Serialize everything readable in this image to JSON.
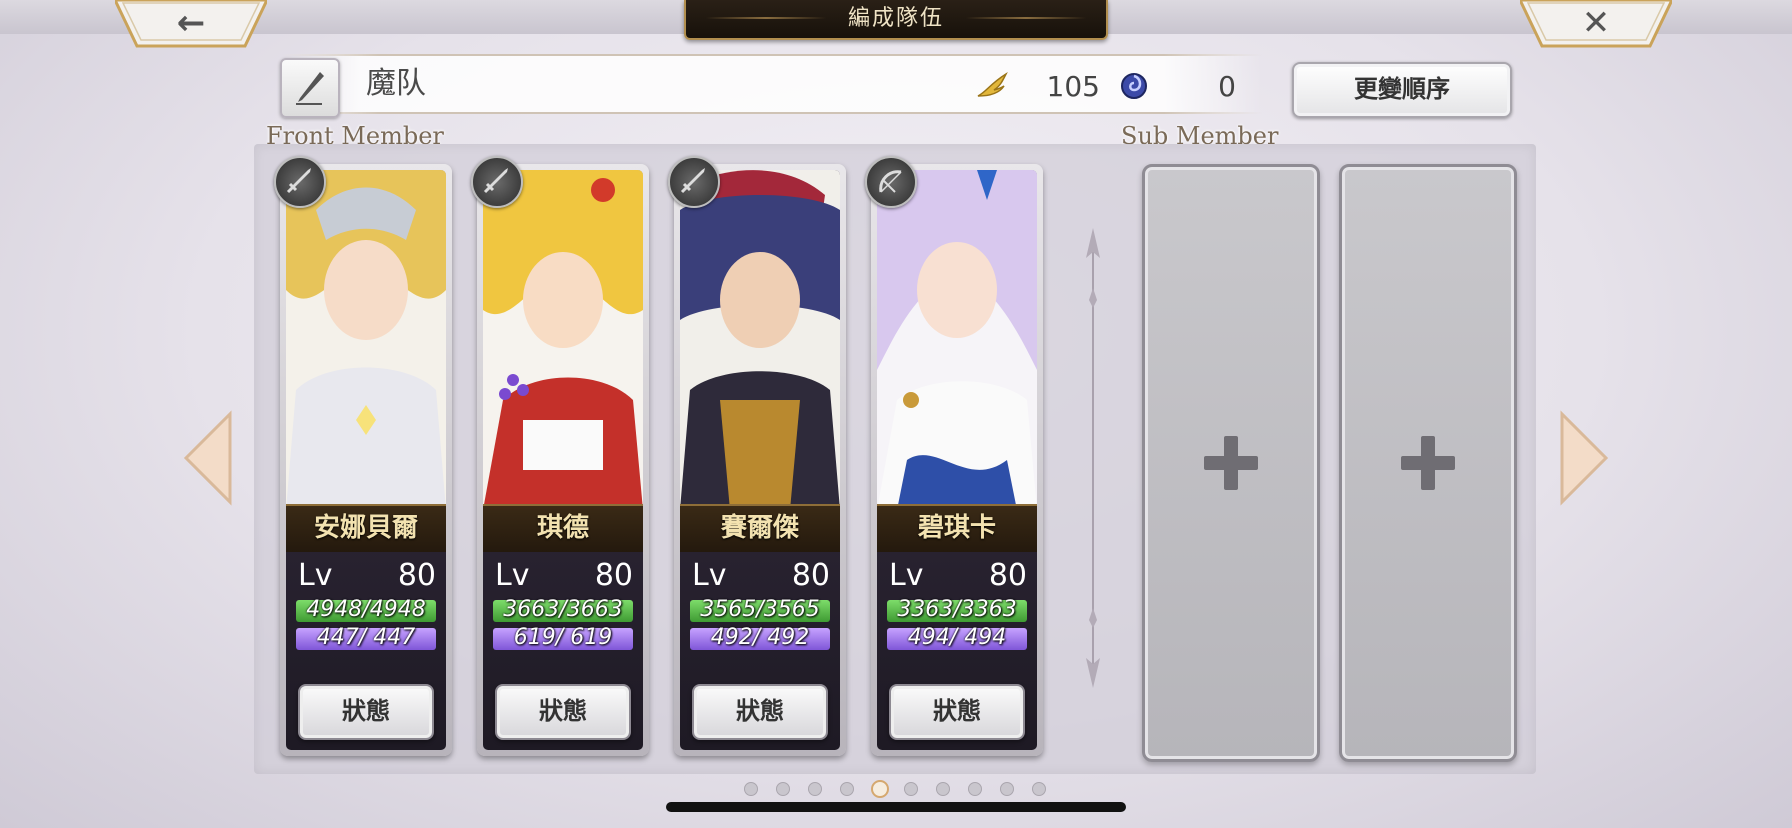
{
  "header": {
    "title": "編成隊伍",
    "back_icon": "←",
    "close_icon": "✕"
  },
  "party": {
    "name": "魔队",
    "wing_count": "105",
    "orb_count": "0",
    "change_order_label": "更變順序"
  },
  "sections": {
    "front_label": "Front Member",
    "sub_label": "Sub Member"
  },
  "members": [
    {
      "name": "安娜貝爾",
      "weapon_icon": "sword-icon",
      "lv_label": "Lv",
      "level": "80",
      "hp": "4948/4948",
      "mp": "447/ 447",
      "status_label": "狀態",
      "accent": "#e7c45a"
    },
    {
      "name": "琪德",
      "weapon_icon": "sword-icon",
      "lv_label": "Lv",
      "level": "80",
      "hp": "3663/3663",
      "mp": "619/ 619",
      "status_label": "狀態",
      "accent": "#f0c640"
    },
    {
      "name": "賽爾傑",
      "weapon_icon": "sword-icon",
      "lv_label": "Lv",
      "level": "80",
      "hp": "3565/3565",
      "mp": "492/ 492",
      "status_label": "狀態",
      "accent": "#3a3f7a"
    },
    {
      "name": "碧琪卡",
      "weapon_icon": "bow-icon",
      "lv_label": "Lv",
      "level": "80",
      "hp": "3363/3363",
      "mp": "494/ 494",
      "status_label": "狀態",
      "accent": "#d8c8ee"
    }
  ],
  "sub_slots": [
    {
      "icon": "plus-icon"
    },
    {
      "icon": "plus-icon"
    }
  ],
  "pagination": {
    "total": 10,
    "active": 4
  },
  "colors": {
    "hp_bar": "#5fbf4a",
    "mp_bar": "#9a72e8",
    "nameplate": "#2e2112",
    "name_text": "#f3e2b0"
  }
}
